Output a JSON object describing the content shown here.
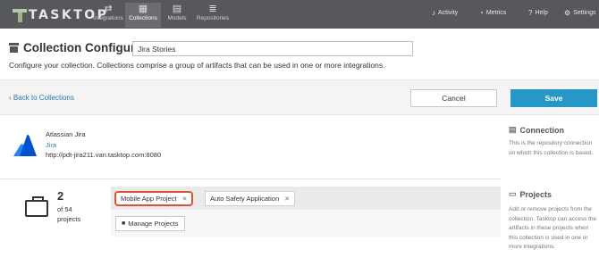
{
  "nav": {
    "logo": "TASKTOP",
    "items": [
      {
        "label": "Integrations",
        "icon": "integrations-icon",
        "glyph": "⇄"
      },
      {
        "label": "Collections",
        "icon": "collections-icon",
        "glyph": "▦"
      },
      {
        "label": "Models",
        "icon": "models-icon",
        "glyph": "▤"
      },
      {
        "label": "Repositories",
        "icon": "repositories-icon",
        "glyph": "≣"
      }
    ],
    "active": "Collections",
    "right": [
      {
        "label": "Activity",
        "icon": "bell-icon",
        "glyph": "♪"
      },
      {
        "label": "Metrics",
        "icon": "gauge-icon",
        "glyph": "◔"
      },
      {
        "label": "Help",
        "icon": "help-icon",
        "glyph": "?"
      },
      {
        "label": "Settings",
        "icon": "gear-icon",
        "glyph": "⚙"
      }
    ]
  },
  "header": {
    "title": "Collection Configuration",
    "name_value": "Jira Stories",
    "description": "Configure your collection. Collections comprise a group of artifacts that can be used in one or more integrations."
  },
  "actions": {
    "back": "Back to Collections",
    "cancel": "Cancel",
    "save": "Save"
  },
  "repository": {
    "type": "Atlassian Jira",
    "name": "Jira",
    "url": "http://pdt-jira211.van.tasktop.com:8080"
  },
  "connection": {
    "title": "Connection",
    "description": "This is the repository connection on which this collection is based."
  },
  "projects": {
    "count": "2",
    "of_total": "of 54",
    "label": "projects",
    "tags": [
      {
        "label": "Mobile App Project",
        "highlighted": true
      },
      {
        "label": "Auto Safety Application",
        "highlighted": false
      }
    ],
    "manage_label": "Manage Projects",
    "side_title": "Projects",
    "side_description": "Add or remove projects from the collection. Tasktop can access the artifacts in these projects when this collection is used in one or more integrations."
  },
  "colors": {
    "nav_bg": "#57585b",
    "accent": "#2698c7",
    "link": "#2a7ab0",
    "highlight": "#d9553a",
    "jira_blue": "#2684ff"
  }
}
